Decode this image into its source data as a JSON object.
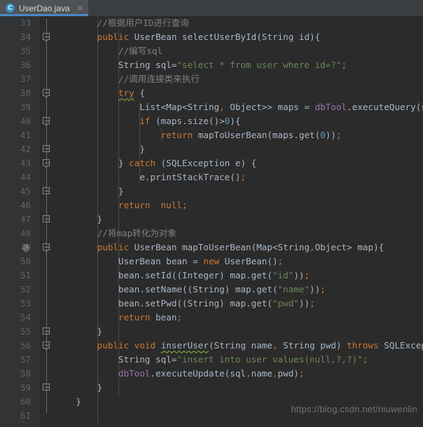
{
  "window": {
    "theme_background": "#2b2b2b",
    "gutter_background": "#313335"
  },
  "tabbar": {
    "tabs": [
      {
        "icon": "java-class-icon",
        "icon_letter": "C",
        "label": "UserDao.java",
        "active": true,
        "close_label": "×"
      }
    ]
  },
  "editor": {
    "language": "Java",
    "first_line": 33,
    "last_line": 61,
    "colors": {
      "keyword": "#cc7832",
      "string": "#6a8759",
      "comment": "#808080",
      "field": "#9876aa",
      "number": "#6897bb",
      "default": "#a9b7c6",
      "line_number": "#606366",
      "accent": "#4a88c7"
    },
    "lines": [
      {
        "n": 33,
        "annot": "",
        "fold": "",
        "text": "        //根据用户ID进行查询"
      },
      {
        "n": 34,
        "annot": "",
        "fold": "start",
        "text": "        public UserBean selectUserById(String id){"
      },
      {
        "n": 35,
        "annot": "",
        "fold": "",
        "text": "            //编写sql"
      },
      {
        "n": 36,
        "annot": "",
        "fold": "",
        "text": "            String sql=\"select * from user where id=?\";"
      },
      {
        "n": 37,
        "annot": "",
        "fold": "",
        "text": "            //调用连接类来执行"
      },
      {
        "n": 38,
        "annot": "",
        "fold": "start",
        "text": "            try {"
      },
      {
        "n": 39,
        "annot": "",
        "fold": "",
        "text": "                List<Map<String, Object>> maps = dbTool.executeQuery(sql, id);"
      },
      {
        "n": 40,
        "annot": "",
        "fold": "start",
        "text": "                if (maps.size()>0){"
      },
      {
        "n": 41,
        "annot": "",
        "fold": "",
        "text": "                    return mapToUserBean(maps.get(0));"
      },
      {
        "n": 42,
        "annot": "",
        "fold": "end",
        "text": "                }"
      },
      {
        "n": 43,
        "annot": "",
        "fold": "start",
        "text": "            } catch (SQLException e) {"
      },
      {
        "n": 44,
        "annot": "",
        "fold": "",
        "text": "                e.printStackTrace();"
      },
      {
        "n": 45,
        "annot": "",
        "fold": "end",
        "text": "            }"
      },
      {
        "n": 46,
        "annot": "",
        "fold": "",
        "text": "            return  null;"
      },
      {
        "n": 47,
        "annot": "",
        "fold": "end",
        "text": "        }"
      },
      {
        "n": 48,
        "annot": "",
        "fold": "",
        "text": "        //将map转化为对象"
      },
      {
        "n": 49,
        "annot": "@",
        "fold": "start",
        "text": "        public UserBean mapToUserBean(Map<String,Object> map){"
      },
      {
        "n": 50,
        "annot": "",
        "fold": "",
        "text": "            UserBean bean = new UserBean();"
      },
      {
        "n": 51,
        "annot": "",
        "fold": "",
        "text": "            bean.setId((Integer) map.get(\"id\"));"
      },
      {
        "n": 52,
        "annot": "",
        "fold": "",
        "text": "            bean.setName((String) map.get(\"name\"));"
      },
      {
        "n": 53,
        "annot": "",
        "fold": "",
        "text": "            bean.setPwd((String) map.get(\"pwd\"));"
      },
      {
        "n": 54,
        "annot": "",
        "fold": "",
        "text": "            return bean;"
      },
      {
        "n": 55,
        "annot": "",
        "fold": "end",
        "text": "        }"
      },
      {
        "n": 56,
        "annot": "",
        "fold": "start",
        "text": "        public void inserUser(String name, String pwd) throws SQLException {"
      },
      {
        "n": 57,
        "annot": "",
        "fold": "",
        "text": "            String sql=\"insert into user values(null,?,?)\";"
      },
      {
        "n": 58,
        "annot": "",
        "fold": "",
        "text": "            dbTool.executeUpdate(sql,name,pwd);"
      },
      {
        "n": 59,
        "annot": "",
        "fold": "end",
        "text": "        }"
      },
      {
        "n": 60,
        "annot": "",
        "fold": "",
        "text": "    }"
      },
      {
        "n": 61,
        "annot": "",
        "fold": "",
        "text": ""
      }
    ]
  },
  "watermark": {
    "text": "https://blog.csdn.net/niuwenlin"
  }
}
